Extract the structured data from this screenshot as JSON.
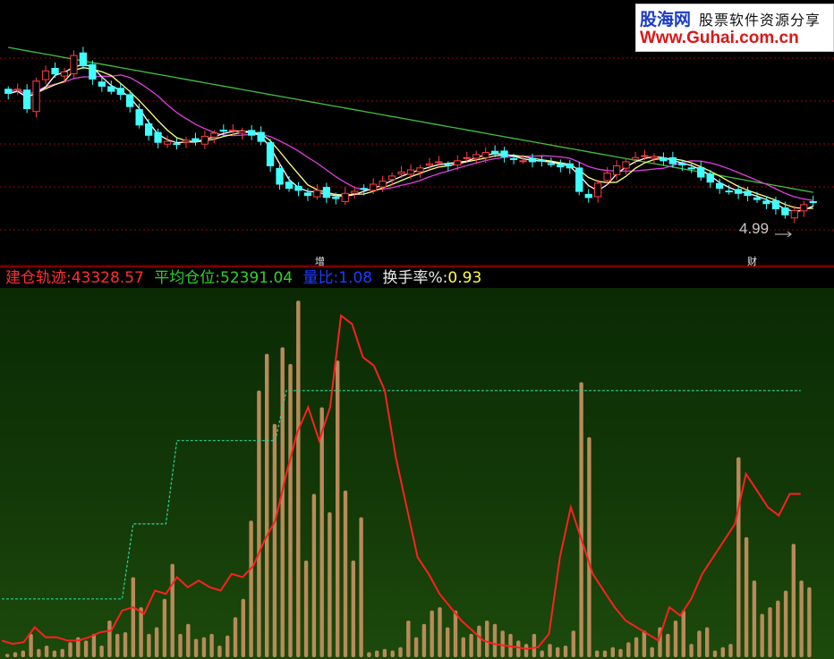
{
  "watermark": {
    "brand": "股海网",
    "slogan": "股票软件资源分享",
    "url": "Www.Guhai.com.cn"
  },
  "markers": {
    "left": "增",
    "right": "财"
  },
  "price_annotation": "4.99",
  "indicator_bar": {
    "items": [
      {
        "label": "建仓轨迹:",
        "value": "43328.57",
        "label_color": "#ff3030",
        "value_color": "#ff3030"
      },
      {
        "label": "平均仓位:",
        "value": "52391.04",
        "label_color": "#30d030",
        "value_color": "#30d030"
      },
      {
        "label": "量比:",
        "value": "1.08",
        "label_color": "#1e3cff",
        "value_color": "#1e3cff"
      },
      {
        "label": "换手率%:",
        "value": "0.93",
        "label_color": "#e8e8e8",
        "value_color": "#ffff40"
      }
    ]
  },
  "colors": {
    "up": "#ff4040",
    "down": "#40ffff",
    "ma5": "#ffffff",
    "ma10": "#ffff80",
    "ma20": "#e040e0",
    "ma60": "#40c040",
    "volume": "#b88a5a",
    "track": "#ff2020",
    "avg": "#30d0a0",
    "grid": "#a00000"
  },
  "chart_data": [
    {
      "type": "candlestick",
      "title": "",
      "closes": [
        6.33,
        6.37,
        6.18,
        6.45,
        6.55,
        6.52,
        6.54,
        6.7,
        6.6,
        6.47,
        6.4,
        6.35,
        6.32,
        6.2,
        6.02,
        5.92,
        5.85,
        5.86,
        5.83,
        5.87,
        5.86,
        5.91,
        5.94,
        5.96,
        5.97,
        5.96,
        5.92,
        5.86,
        5.62,
        5.44,
        5.4,
        5.38,
        5.33,
        5.38,
        5.31,
        5.3,
        5.35,
        5.37,
        5.39,
        5.44,
        5.47,
        5.52,
        5.56,
        5.58,
        5.6,
        5.64,
        5.66,
        5.63,
        5.67,
        5.7,
        5.73,
        5.75,
        5.74,
        5.71,
        5.69,
        5.67,
        5.66,
        5.67,
        5.64,
        5.61,
        5.6,
        5.37,
        5.31,
        5.45,
        5.55,
        5.62,
        5.66,
        5.7,
        5.72,
        5.71,
        5.67,
        5.64,
        5.63,
        5.6,
        5.51,
        5.46,
        5.4,
        5.37,
        5.35,
        5.33,
        5.29,
        5.25,
        5.2,
        5.14,
        5.18,
        5.24,
        5.26
      ],
      "ma_lines": [
        "MA5",
        "MA10",
        "MA20",
        "MA60"
      ],
      "annotation": "4.99"
    },
    {
      "type": "bar",
      "title": "",
      "series": [
        {
          "name": "volume",
          "values": [
            2,
            3,
            4,
            14,
            5,
            7,
            4,
            5,
            9,
            12,
            10,
            14,
            7,
            22,
            14,
            15,
            48,
            30,
            14,
            18,
            35,
            56,
            14,
            20,
            11,
            12,
            14,
            7,
            13,
            24,
            35,
            82,
            160,
            182,
            140,
            186,
            176,
            214,
            58,
            98,
            150,
            87,
            178,
            100,
            58,
            84,
            3,
            4,
            5,
            4,
            6,
            22,
            12,
            20,
            28,
            30,
            18,
            28,
            12,
            14,
            19,
            22,
            20,
            16,
            14,
            10,
            8,
            14,
            4,
            8,
            6,
            7,
            16,
            165,
            132,
            4,
            4,
            6,
            5,
            9,
            12,
            16,
            6,
            18,
            14,
            22,
            28,
            8,
            16,
            18,
            4,
            6,
            8,
            120,
            72,
            46,
            26,
            30,
            34,
            40,
            68,
            46,
            42
          ]
        },
        {
          "name": "建仓轨迹",
          "values": [
            10,
            8,
            9,
            18,
            12,
            12,
            10,
            10,
            12,
            15,
            16,
            28,
            30,
            26,
            40,
            38,
            48,
            42,
            46,
            42,
            40,
            50,
            48,
            55,
            70,
            82,
            110,
            135,
            150,
            130,
            150,
            205,
            200,
            180,
            175,
            160,
            120,
            90,
            60,
            50,
            38,
            30,
            22,
            16,
            10,
            8,
            7,
            6,
            5,
            6,
            14,
            60,
            90,
            70,
            50,
            40,
            30,
            22,
            18,
            14,
            10,
            30,
            25,
            35,
            50,
            60,
            70,
            80,
            110,
            100,
            90,
            85,
            98,
            98
          ]
        },
        {
          "name": "平均仓位",
          "values": [
            35,
            35,
            35,
            35,
            35,
            35,
            35,
            35,
            35,
            35,
            35,
            35,
            80,
            80,
            80,
            80,
            130,
            130,
            130,
            130,
            130,
            130,
            130,
            130,
            130,
            130,
            160,
            160,
            160,
            160,
            160,
            160,
            160,
            160,
            160,
            160,
            160,
            160,
            160,
            160,
            160,
            160,
            160,
            160,
            160,
            160,
            160,
            160,
            160,
            160,
            160,
            160,
            160,
            160,
            160,
            160,
            160,
            160,
            160,
            160,
            160,
            160,
            160,
            160,
            160,
            160,
            160,
            160,
            160,
            160,
            160,
            160,
            160,
            160,
            160,
            160,
            160,
            160,
            160,
            160,
            160,
            160,
            160,
            160,
            160,
            160,
            160,
            160,
            160,
            160,
            160,
            160,
            160,
            160
          ]
        }
      ]
    }
  ]
}
